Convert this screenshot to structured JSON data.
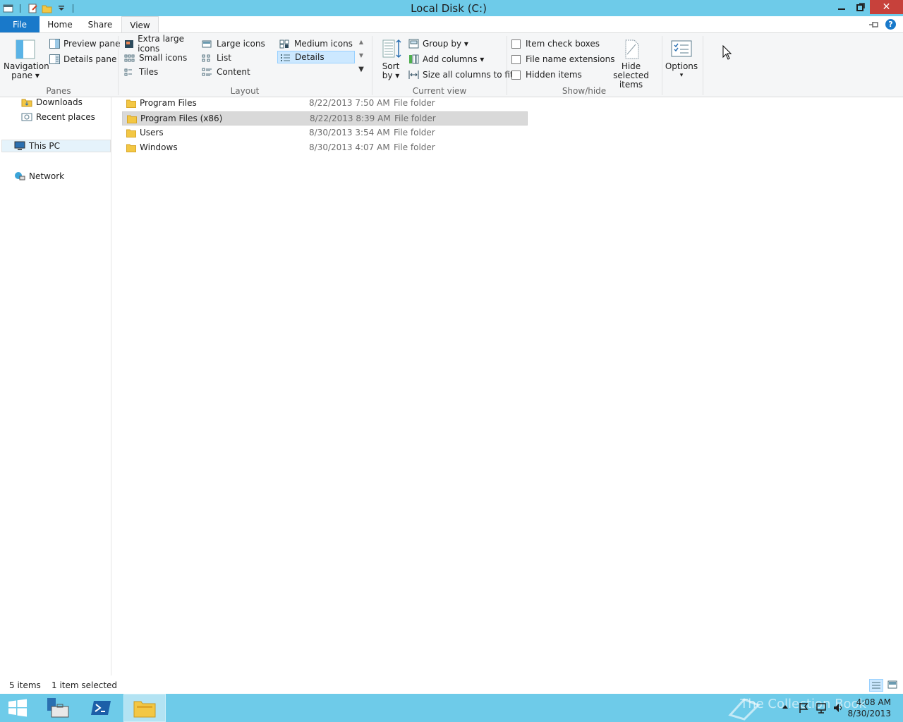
{
  "window": {
    "title": "Local Disk (C:)",
    "minimize": "▁",
    "restore": "⧉",
    "close": "✕"
  },
  "tabs": {
    "file": "File",
    "home": "Home",
    "share": "Share",
    "view": "View"
  },
  "ribbon": {
    "panes": {
      "label": "Panes",
      "navigation_pane_1": "Navigation",
      "navigation_pane_2": "pane ▾",
      "preview_pane": "Preview pane",
      "details_pane": "Details pane"
    },
    "layout": {
      "label": "Layout",
      "extra_large_icons": "Extra large icons",
      "large_icons": "Large icons",
      "medium_icons": "Medium icons",
      "small_icons": "Small icons",
      "list": "List",
      "details": "Details",
      "tiles": "Tiles",
      "content": "Content",
      "selected": "Details"
    },
    "current_view": {
      "label": "Current view",
      "sort_by_1": "Sort",
      "sort_by_2": "by ▾",
      "group_by": "Group by ▾",
      "add_columns": "Add columns ▾",
      "size_all_columns": "Size all columns to fit"
    },
    "show_hide": {
      "label": "Show/hide",
      "item_check_boxes": "Item check boxes",
      "file_name_extensions": "File name extensions",
      "hidden_items": "Hidden items",
      "hide_selected_1": "Hide selected",
      "hide_selected_2": "items"
    },
    "options": {
      "label": "Options",
      "arrow": "▾"
    }
  },
  "nav": {
    "downloads": "Downloads",
    "recent_places": "Recent places",
    "this_pc": "This PC",
    "network": "Network"
  },
  "files": [
    {
      "name": "Program Files",
      "date": "8/22/2013 7:50 AM",
      "type": "File folder"
    },
    {
      "name": "Program Files (x86)",
      "date": "8/22/2013 8:39 AM",
      "type": "File folder"
    },
    {
      "name": "Users",
      "date": "8/30/2013 3:54 AM",
      "type": "File folder"
    },
    {
      "name": "Windows",
      "date": "8/30/2013 4:07 AM",
      "type": "File folder"
    }
  ],
  "status": {
    "item_count": "5 items",
    "selection": "1 item selected"
  },
  "taskbar": {
    "time": "4:08 AM",
    "date": "8/30/2013",
    "watermark": "The Collection Book"
  },
  "colors": {
    "titlebar": "#6ecbe9",
    "file_tab": "#1979ca",
    "close": "#c7413b",
    "selection": "#cce8ff"
  }
}
